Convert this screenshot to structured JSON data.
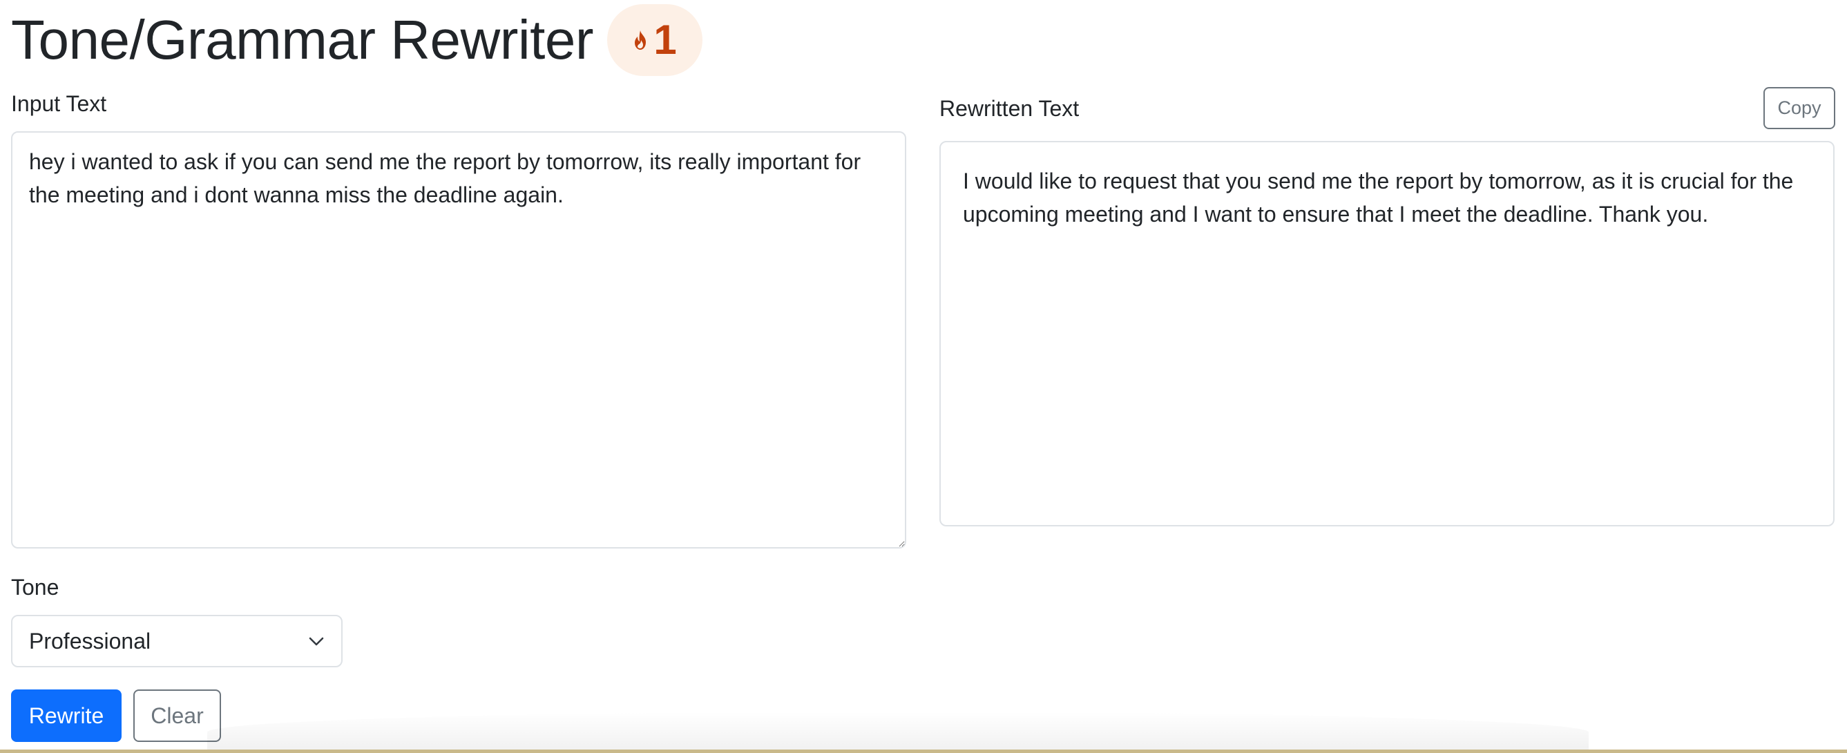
{
  "header": {
    "title": "Tone/Grammar Rewriter",
    "streak": {
      "icon": "flame-icon",
      "count": "1",
      "color": "#c2410c",
      "background": "#fdf0e6"
    }
  },
  "input": {
    "label": "Input Text",
    "value": "hey i wanted to ask if you can send me the report by tomorrow, its really important for the meeting and i dont wanna miss the deadline again."
  },
  "output": {
    "label": "Rewritten Text",
    "copy_label": "Copy",
    "text": "I would like to request that you send me the report by tomorrow, as it is crucial for the upcoming meeting and I want to ensure that I meet the deadline. Thank you."
  },
  "tone": {
    "label": "Tone",
    "selected": "Professional",
    "icon": "chevron-down-icon"
  },
  "actions": {
    "rewrite_label": "Rewrite",
    "clear_label": "Clear"
  },
  "colors": {
    "primary": "#0d6efd",
    "secondary": "#6c757d",
    "border": "#dee2e6",
    "text": "#212529"
  }
}
